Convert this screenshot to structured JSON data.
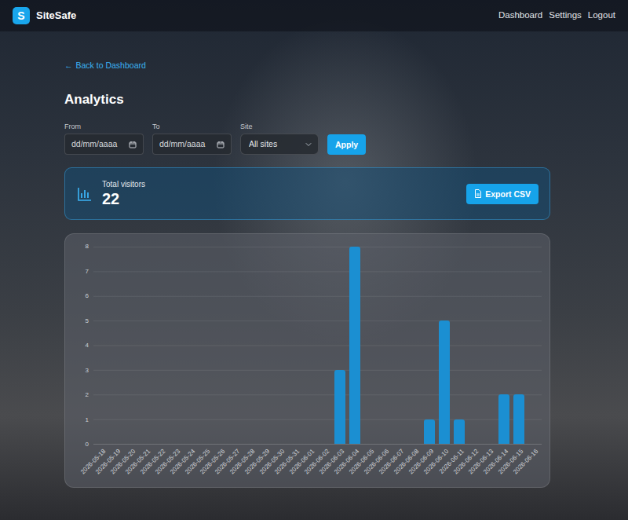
{
  "navbar": {
    "logo": "S",
    "brand": "SiteSafe",
    "links": [
      "Dashboard",
      "Settings",
      "Logout"
    ]
  },
  "back_link": {
    "icon": "←",
    "label": "Back to Dashboard"
  },
  "title": "Analytics",
  "filters": {
    "from": {
      "label": "From",
      "placeholder": "dd/mm/aaaa"
    },
    "to": {
      "label": "To",
      "placeholder": "dd/mm/aaaa"
    },
    "site": {
      "label": "Site",
      "value": "All sites"
    },
    "apply": "Apply"
  },
  "summary": {
    "label": "Total visitors",
    "value": "22",
    "export": "Export CSV"
  },
  "chart": {
    "y_ticks": [
      "0",
      "1",
      "2",
      "3",
      "4",
      "5",
      "6",
      "7",
      "8"
    ],
    "x_labels": [
      "2026-05-18",
      "2026-05-19",
      "2026-05-20",
      "2026-05-21",
      "2026-05-22",
      "2026-05-23",
      "2026-05-24",
      "2026-05-25",
      "2026-05-26",
      "2026-05-27",
      "2026-05-28",
      "2026-05-29",
      "2026-05-30",
      "2026-05-31",
      "2026-06-01",
      "2026-06-02",
      "2026-06-03",
      "2026-06-04",
      "2026-06-05",
      "2026-06-06",
      "2026-06-07",
      "2026-06-08",
      "2026-06-09",
      "2026-06-10",
      "2026-06-11",
      "2026-06-12",
      "2026-06-13",
      "2026-06-14",
      "2026-06-15",
      "2026-06-16"
    ],
    "values": [
      0,
      0,
      0,
      0,
      0,
      0,
      0,
      0,
      0,
      0,
      0,
      0,
      0,
      0,
      0,
      0,
      3,
      8,
      0,
      0,
      0,
      0,
      1,
      5,
      1,
      0,
      0,
      2,
      2,
      0
    ]
  }
}
